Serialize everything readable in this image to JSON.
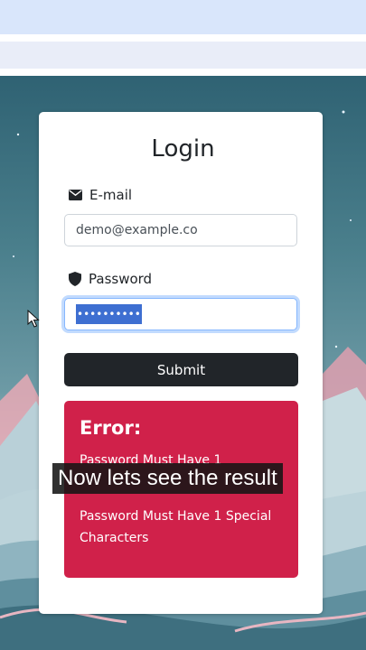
{
  "form": {
    "title": "Login",
    "email_label": "E-mail",
    "email_value": "demo@example.co",
    "password_label": "Password",
    "password_value": "••••••••••",
    "submit_label": "Submit"
  },
  "error": {
    "title": "Error:",
    "messages": [
      "Password Must Have 1",
      "Password Must Have 1 Special Characters"
    ]
  },
  "caption": "Now lets see the result",
  "colors": {
    "error_bg": "#d0214a",
    "submit_bg": "#212529",
    "selection": "#3e6fd1"
  },
  "icons": {
    "email": "envelope-icon",
    "password": "shield-icon",
    "cursor": "mouse-pointer-icon"
  }
}
